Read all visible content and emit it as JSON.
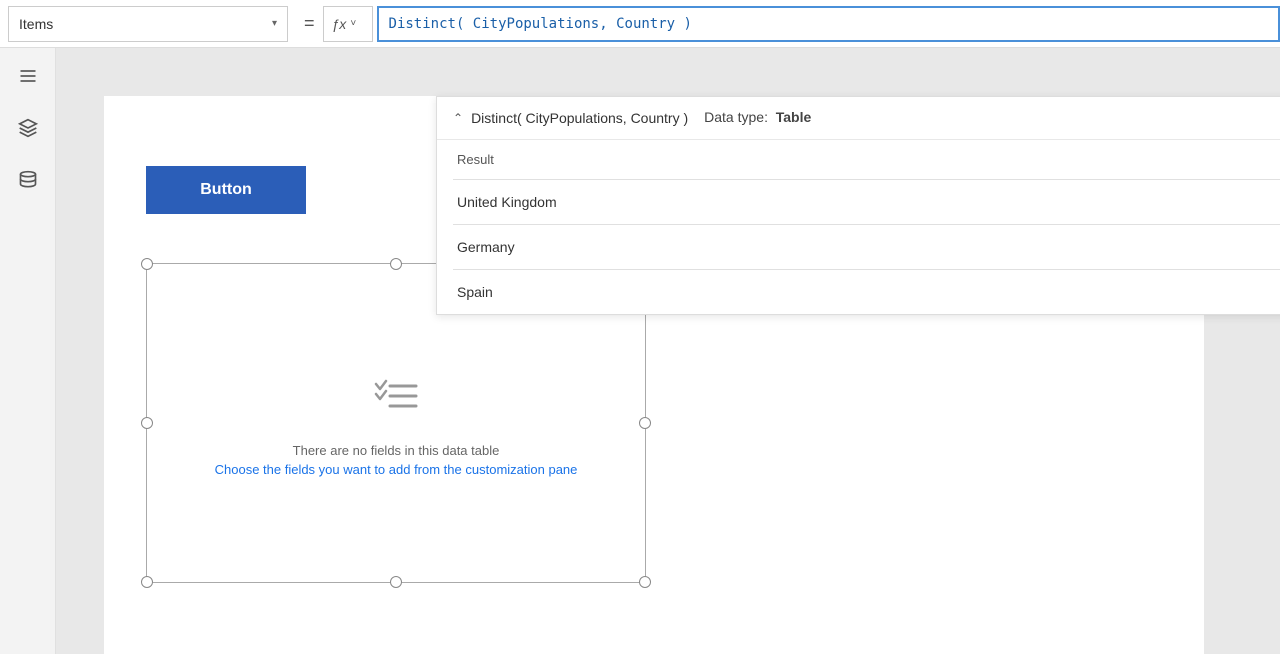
{
  "topbar": {
    "items_label": "Items",
    "items_dropdown_chevron": "▾",
    "equals_sign": "=",
    "fx_label": "ƒx",
    "fx_chevron": "˅",
    "formula_value": "Distinct( CityPopulations, Country )"
  },
  "sidebar": {
    "icons": [
      {
        "name": "hamburger-menu-icon",
        "label": "Menu"
      },
      {
        "name": "layers-icon",
        "label": "Layers"
      },
      {
        "name": "database-icon",
        "label": "Data"
      }
    ]
  },
  "canvas": {
    "button_label": "Button",
    "empty_state_text": "There are no fields in this data table",
    "empty_state_link": "Choose the fields you want to add from the customization pane"
  },
  "dropdown": {
    "formula": "Distinct( CityPopulations, Country )",
    "datatype_label": "Data type:",
    "datatype_value": "Table",
    "result_header": "Result",
    "items": [
      {
        "value": "United Kingdom"
      },
      {
        "value": "Germany"
      },
      {
        "value": "Spain"
      }
    ]
  }
}
